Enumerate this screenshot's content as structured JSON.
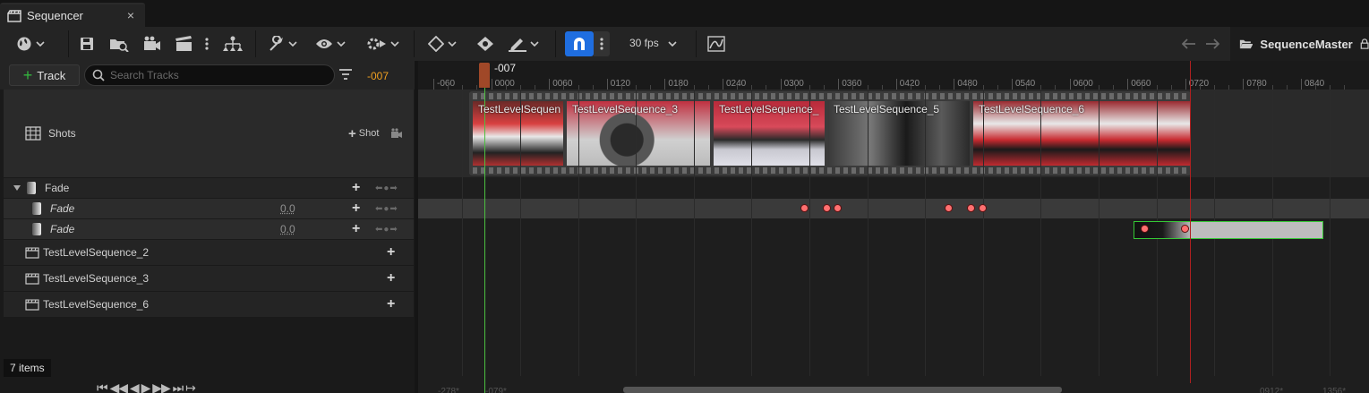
{
  "tab": {
    "title": "Sequencer",
    "close": "×"
  },
  "toolbar": {
    "fps": "30 fps",
    "sequence_name": "SequenceMaster"
  },
  "left": {
    "track_button": "Track",
    "search_placeholder": "Search Tracks",
    "current_frame": "-007",
    "rows": {
      "shots": "Shots",
      "shot_add": "Shot",
      "fade": "Fade",
      "fade1": "Fade",
      "fade1_value": "0.0",
      "fade2": "Fade",
      "fade2_value": "0.0",
      "ts2": "TestLevelSequence_2",
      "ts3": "TestLevelSequence_3",
      "ts6": "TestLevelSequence_6"
    },
    "items_count": "7 items"
  },
  "timeline": {
    "playhead_label": "-007",
    "ticks": [
      "-060",
      "0000",
      "0060",
      "0120",
      "0180",
      "0240",
      "0300",
      "0360",
      "0420",
      "0480",
      "0540",
      "0600",
      "0660",
      "0720",
      "0780",
      "0840"
    ],
    "shots": [
      "TestLevelSequen",
      "TestLevelSequence_3",
      "TestLevelSequence_",
      "TestLevelSequence_5",
      "TestLevelSequence_6"
    ],
    "bottom": [
      "-278*",
      "-079*",
      "0912*",
      "1356*"
    ]
  },
  "colors": {
    "accent": "#1f6ee0",
    "playhead": "#4cc040",
    "end_marker": "#b02020",
    "key": "#ff7070",
    "frame_label": "#f0a020"
  }
}
